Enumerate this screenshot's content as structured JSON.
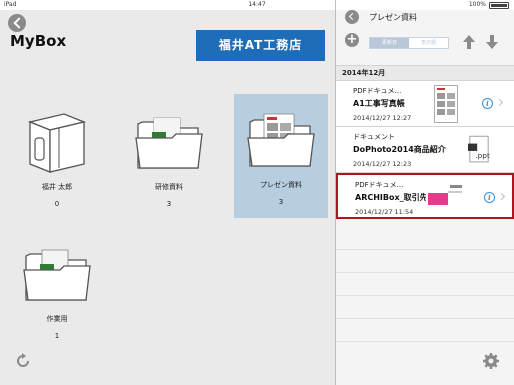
{
  "status": {
    "device": "iPad",
    "time": "14:47",
    "battery": "100%"
  },
  "left": {
    "title": "MyBox",
    "company_button": "福井AT工務店",
    "tiles": [
      {
        "name": "福井 太郎",
        "count": "0",
        "icon": "box-folder-icon"
      },
      {
        "name": "研修資料",
        "count": "3",
        "icon": "folder-xls-icon"
      },
      {
        "name": "プレゼン資料",
        "count": "3",
        "icon": "folder-document-icon",
        "selected": true
      },
      {
        "name": "作業用",
        "count": "1",
        "icon": "folder-xls-icon"
      }
    ]
  },
  "right": {
    "title": "プレゼン資料",
    "sort_tabs": [
      "更新日",
      "表示順"
    ],
    "section": "2014年12月",
    "items": [
      {
        "type": "PDFドキュメ...",
        "title": "A1工事写真帳",
        "date": "2014/12/27 12:27"
      },
      {
        "type": "ドキュメント",
        "title": "DoPhoto2014商品紹介",
        "date": "2014/12/27 12:23"
      },
      {
        "type": "PDFドキュメ...",
        "title": "ARCHIBox_取引先操作",
        "date": "2014/12/27 11:54"
      }
    ]
  },
  "colors": {
    "accent": "#1e6db8",
    "selection": "#b7cde0",
    "highlight_border": "#b0141e"
  }
}
